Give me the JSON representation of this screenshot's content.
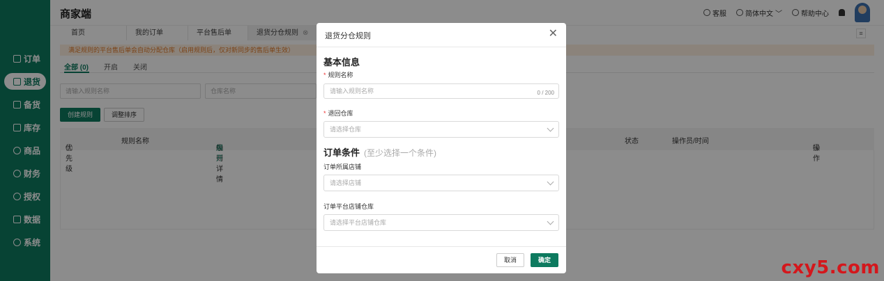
{
  "app": {
    "title": "商家端"
  },
  "header": {
    "service": "客服",
    "language": "简体中文",
    "help": "帮助中心"
  },
  "sidebar": {
    "items": [
      {
        "label": "订单",
        "icon": "order-icon"
      },
      {
        "label": "退货",
        "icon": "return-icon",
        "active": true
      },
      {
        "label": "备货",
        "icon": "stock-prep-icon"
      },
      {
        "label": "库存",
        "icon": "inventory-icon"
      },
      {
        "label": "商品",
        "icon": "goods-icon"
      },
      {
        "label": "财务",
        "icon": "finance-icon"
      },
      {
        "label": "授权",
        "icon": "auth-icon"
      },
      {
        "label": "数据",
        "icon": "data-icon"
      },
      {
        "label": "系统",
        "icon": "system-icon"
      }
    ]
  },
  "tabs": [
    {
      "label": "首页"
    },
    {
      "label": "我的订单"
    },
    {
      "label": "平台售后单"
    },
    {
      "label": "退货分仓规则",
      "active": true
    }
  ],
  "main": {
    "notice": "满足规则的平台售后单会自动分配仓库（启用规则后，仅对新同步的售后单生效）",
    "subtabs": [
      "全部 (0)",
      "开启",
      "关闭"
    ],
    "filters": {
      "rule_name_placeholder": "请输入规则名称",
      "warehouse_placeholder": "仓库名称"
    },
    "buttons": {
      "create": "创建规则",
      "reorder": "调整排序"
    },
    "columns": {
      "priority": "优先级",
      "name": "规则名称",
      "detail": "规则详情",
      "expand": "展开",
      "status": "状态",
      "operator": "操作员/时间",
      "actions": "操作"
    }
  },
  "modal": {
    "title": "退货分仓规则",
    "basic_section": "基本信息",
    "rule_name_label": "规则名称",
    "rule_name_placeholder": "请输入规则名称",
    "rule_name_count": "0 / 200",
    "warehouse_label": "退回仓库",
    "warehouse_placeholder": "请选择仓库",
    "condition_section": "订单条件",
    "condition_hint": "(至少选择一个条件)",
    "shop_label": "订单所属店铺",
    "shop_placeholder": "请选择店铺",
    "platform_wh_label": "订单平台店铺仓库",
    "platform_wh_placeholder": "请选择平台店铺仓库",
    "cancel": "取消",
    "confirm": "确定"
  },
  "watermark": "cxy5.com",
  "colors": {
    "brand": "#0d7a5f",
    "notice_bg": "#fdeee0",
    "notice_text": "#e07b2a",
    "required": "#e33333"
  }
}
